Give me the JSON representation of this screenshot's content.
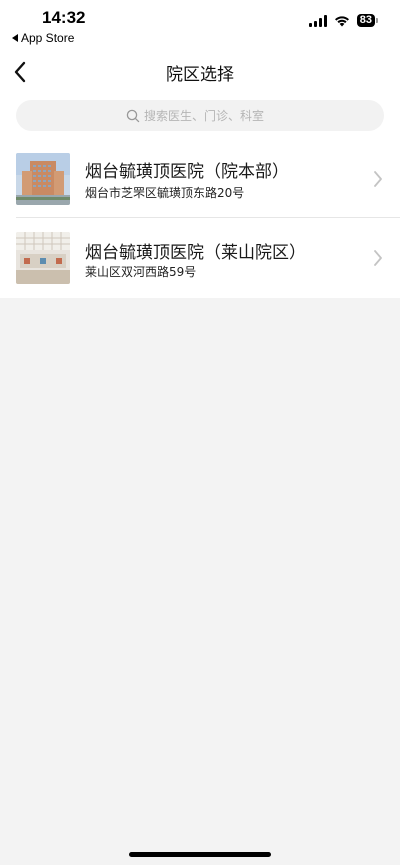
{
  "status_bar": {
    "time": "14:32",
    "back_app": "App Store",
    "battery": "83"
  },
  "nav": {
    "title": "院区选择"
  },
  "search": {
    "placeholder": "搜索医生、门诊、科室"
  },
  "hospitals": [
    {
      "name": "烟台毓璜顶医院（院本部）",
      "address": "烟台市芝罘区毓璜顶东路20号"
    },
    {
      "name": "烟台毓璜顶医院（莱山院区）",
      "address": "莱山区双河西路59号"
    }
  ]
}
